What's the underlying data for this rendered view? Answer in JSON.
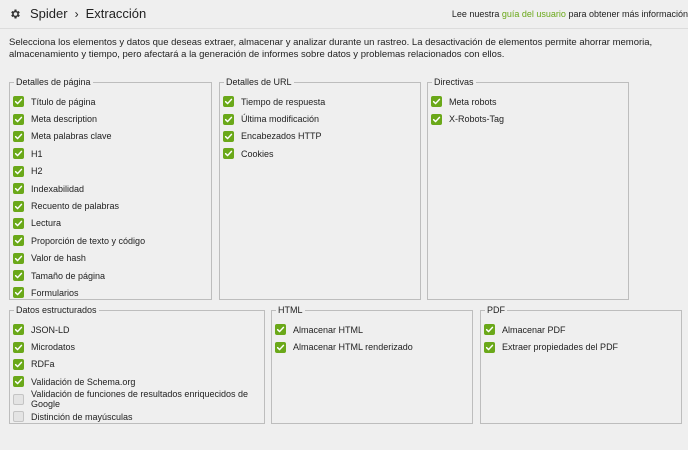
{
  "header": {
    "breadcrumb_root": "Spider",
    "breadcrumb_separator": "›",
    "breadcrumb_current": "Extracción",
    "help_prefix": "Lee nuestra ",
    "help_link": "guía del usuario",
    "help_suffix": " para obtener más información"
  },
  "description": "Selecciona los elementos y datos que deseas extraer, almacenar y analizar durante un rastreo. La desactivación de elementos permite ahorrar memoria, almacenamiento y tiempo, pero afectará a la generación de informes sobre datos y problemas relacionados con ellos.",
  "colors": {
    "accent": "#6aa819",
    "background": "#efefef",
    "border": "#bdbdbd"
  },
  "groups": {
    "page_details": {
      "title": "Detalles de página",
      "items": [
        {
          "label": "Título de página",
          "checked": true
        },
        {
          "label": "Meta description",
          "checked": true
        },
        {
          "label": "Meta palabras clave",
          "checked": true
        },
        {
          "label": "H1",
          "checked": true
        },
        {
          "label": "H2",
          "checked": true
        },
        {
          "label": "Indexabilidad",
          "checked": true
        },
        {
          "label": "Recuento de palabras",
          "checked": true
        },
        {
          "label": "Lectura",
          "checked": true
        },
        {
          "label": "Proporción de texto y código",
          "checked": true
        },
        {
          "label": "Valor de hash",
          "checked": true
        },
        {
          "label": "Tamaño de página",
          "checked": true
        },
        {
          "label": "Formularios",
          "checked": true
        }
      ]
    },
    "url_details": {
      "title": "Detalles de URL",
      "items": [
        {
          "label": "Tiempo de respuesta",
          "checked": true
        },
        {
          "label": "Última modificación",
          "checked": true
        },
        {
          "label": "Encabezados HTTP",
          "checked": true
        },
        {
          "label": "Cookies",
          "checked": true
        }
      ]
    },
    "directives": {
      "title": "Directivas",
      "items": [
        {
          "label": "Meta robots",
          "checked": true
        },
        {
          "label": "X-Robots-Tag",
          "checked": true
        }
      ]
    },
    "structured_data": {
      "title": "Datos estructurados",
      "items": [
        {
          "label": "JSON-LD",
          "checked": true
        },
        {
          "label": "Microdatos",
          "checked": true
        },
        {
          "label": "RDFa",
          "checked": true
        },
        {
          "label": "Validación de Schema.org",
          "checked": true
        },
        {
          "label": "Validación de funciones de resultados enriquecidos de Google",
          "checked": false
        },
        {
          "label": "Distinción de mayúsculas",
          "checked": false
        }
      ]
    },
    "html": {
      "title": "HTML",
      "items": [
        {
          "label": "Almacenar HTML",
          "checked": true
        },
        {
          "label": "Almacenar HTML renderizado",
          "checked": true
        }
      ]
    },
    "pdf": {
      "title": "PDF",
      "items": [
        {
          "label": "Almacenar PDF",
          "checked": true
        },
        {
          "label": "Extraer propiedades del PDF",
          "checked": true
        }
      ]
    }
  }
}
